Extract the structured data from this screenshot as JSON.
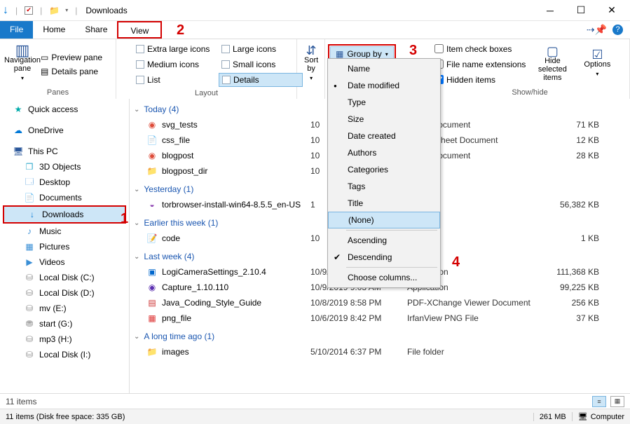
{
  "window": {
    "title": "Downloads"
  },
  "menu": {
    "file": "File",
    "home": "Home",
    "share": "Share",
    "view": "View"
  },
  "ribbon": {
    "navpane": "Navigation pane",
    "preview": "Preview pane",
    "details": "Details pane",
    "panes": "Panes",
    "layout": {
      "extra_large": "Extra large icons",
      "large": "Large icons",
      "medium": "Medium icons",
      "small": "Small icons",
      "list": "List",
      "details": "Details",
      "label": "Layout"
    },
    "sortby": "Sort by",
    "groupby": "Group by",
    "showhide": {
      "check_boxes": "Item check boxes",
      "extensions": "File name extensions",
      "hidden": "Hidden items",
      "label": "Show/hide"
    },
    "hide_selected": "Hide selected items",
    "options": "Options"
  },
  "groupby_menu": {
    "name": "Name",
    "date_modified": "Date modified",
    "type": "Type",
    "size": "Size",
    "date_created": "Date created",
    "authors": "Authors",
    "categories": "Categories",
    "tags": "Tags",
    "title": "Title",
    "none": "(None)",
    "ascending": "Ascending",
    "descending": "Descending",
    "choose": "Choose columns..."
  },
  "nav": {
    "quick": "Quick access",
    "onedrive": "OneDrive",
    "thispc": "This PC",
    "objects": "3D Objects",
    "desktop": "Desktop",
    "documents": "Documents",
    "downloads": "Downloads",
    "music": "Music",
    "pictures": "Pictures",
    "videos": "Videos",
    "c": "Local Disk (C:)",
    "d": "Local Disk (D:)",
    "e": "mv (E:)",
    "g": "start (G:)",
    "h": "mp3 (H:)",
    "i": "Local Disk (I:)"
  },
  "groups": {
    "today": "Today (4)",
    "yesterday": "Yesterday (1)",
    "earlier": "Earlier this week (1)",
    "lastweek": "Last week (4)",
    "longago": "A long time ago (1)"
  },
  "files": [
    {
      "name": "svg_tests",
      "date": "10",
      "type": "HTML Document",
      "size": "71 KB",
      "icon": "chrome"
    },
    {
      "name": "css_file",
      "date": "10",
      "type": "g Style Sheet Document",
      "size": "12 KB",
      "icon": "doc"
    },
    {
      "name": "blogpost",
      "date": "10",
      "type": "HTML Document",
      "size": "28 KB",
      "icon": "chrome"
    },
    {
      "name": "blogpost_dir",
      "date": "10",
      "type": "",
      "size": "",
      "icon": "folder"
    },
    {
      "name": "torbrowser-install-win64-8.5.5_en-US",
      "date": "1",
      "type": "on",
      "size": "56,382 KB",
      "icon": "tor"
    },
    {
      "name": "code",
      "date": "10",
      "type": "",
      "size": "1 KB",
      "icon": "doc"
    },
    {
      "name": "LogiCameraSettings_2.10.4",
      "date": "10/9/2019 10:22 AM",
      "type": "Application",
      "size": "111,368 KB",
      "icon": "app"
    },
    {
      "name": "Capture_1.10.110",
      "date": "10/9/2019 9:03 AM",
      "type": "Application",
      "size": "99,225 KB",
      "icon": "app2"
    },
    {
      "name": "Java_Coding_Style_Guide",
      "date": "10/8/2019 8:58 PM",
      "type": "PDF-XChange Viewer Document",
      "size": "256 KB",
      "icon": "pdf"
    },
    {
      "name": "png_file",
      "date": "10/6/2019 8:42 PM",
      "type": "IrfanView PNG File",
      "size": "37 KB",
      "icon": "img"
    },
    {
      "name": "images",
      "date": "5/10/2014 6:37 PM",
      "type": "File folder",
      "size": "",
      "icon": "folder"
    }
  ],
  "status": {
    "items": "11 items",
    "free": "11 items (Disk free space: 335 GB)",
    "mem": "261 MB",
    "computer": "Computer"
  },
  "anno": {
    "a1": "1",
    "a2": "2",
    "a3": "3",
    "a4": "4"
  }
}
